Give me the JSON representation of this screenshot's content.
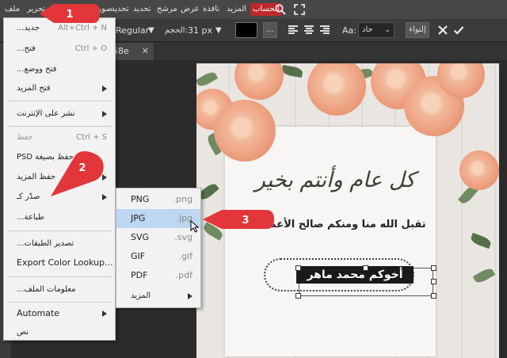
{
  "menubar": {
    "items": [
      "ملف",
      "تحرير",
      "صورة",
      "تحديد",
      "تحديد",
      "مرشح",
      "عرض",
      "نافذة",
      "المزيد"
    ],
    "account": "الحساب"
  },
  "options": {
    "font_style": "Regular",
    "size_label": "الحجم:",
    "size_value": "31 px",
    "dots": "...",
    "aa_label": "Aa:",
    "aa_value": "حاد",
    "warp": "إلتواء"
  },
  "tab": {
    "name": "58e",
    "close": "✕"
  },
  "file_menu": {
    "items": [
      {
        "label": "جديد...",
        "shortcut": "Alt+Ctrl + N"
      },
      {
        "label": "فتح...",
        "shortcut": "Ctrl + O"
      },
      {
        "label": "فتح ووضع..."
      },
      {
        "label": "فتح المزيد"
      },
      {
        "label": "نشر على الإنترنت"
      },
      {
        "label": "حفظ",
        "shortcut": "Ctrl + S"
      },
      {
        "label": "حفظ بصيغة PSD"
      },
      {
        "label": "حفظ المزيد"
      },
      {
        "label": "صدّر كـ"
      },
      {
        "label": "طباعة..."
      },
      {
        "label": "تصدير الطبقات..."
      },
      {
        "label": "Export Color Lookup..."
      },
      {
        "label": "معلومات الملف..."
      },
      {
        "label": "Automate"
      },
      {
        "label": "نص"
      }
    ]
  },
  "export_submenu": {
    "items": [
      {
        "name": "PNG",
        "ext": ".png"
      },
      {
        "name": "JPG",
        "ext": ".jpg"
      },
      {
        "name": "SVG",
        "ext": ".svg"
      },
      {
        "name": "GIF",
        "ext": ".gif"
      },
      {
        "name": "PDF",
        "ext": ".pdf"
      },
      {
        "name": "المزيد"
      }
    ]
  },
  "canvas": {
    "greeting": "كل عام وأنتم بخير",
    "subline": "تقبل الله منا ومنكم صالح الأعمال",
    "signature": "أخوكم محمد ماهر"
  },
  "callouts": [
    "1",
    "2",
    "3"
  ],
  "colors": {
    "callout": "#e2363a",
    "menubar": "#474747",
    "highlight": "#bcd7ef",
    "account": "#c0282d"
  }
}
